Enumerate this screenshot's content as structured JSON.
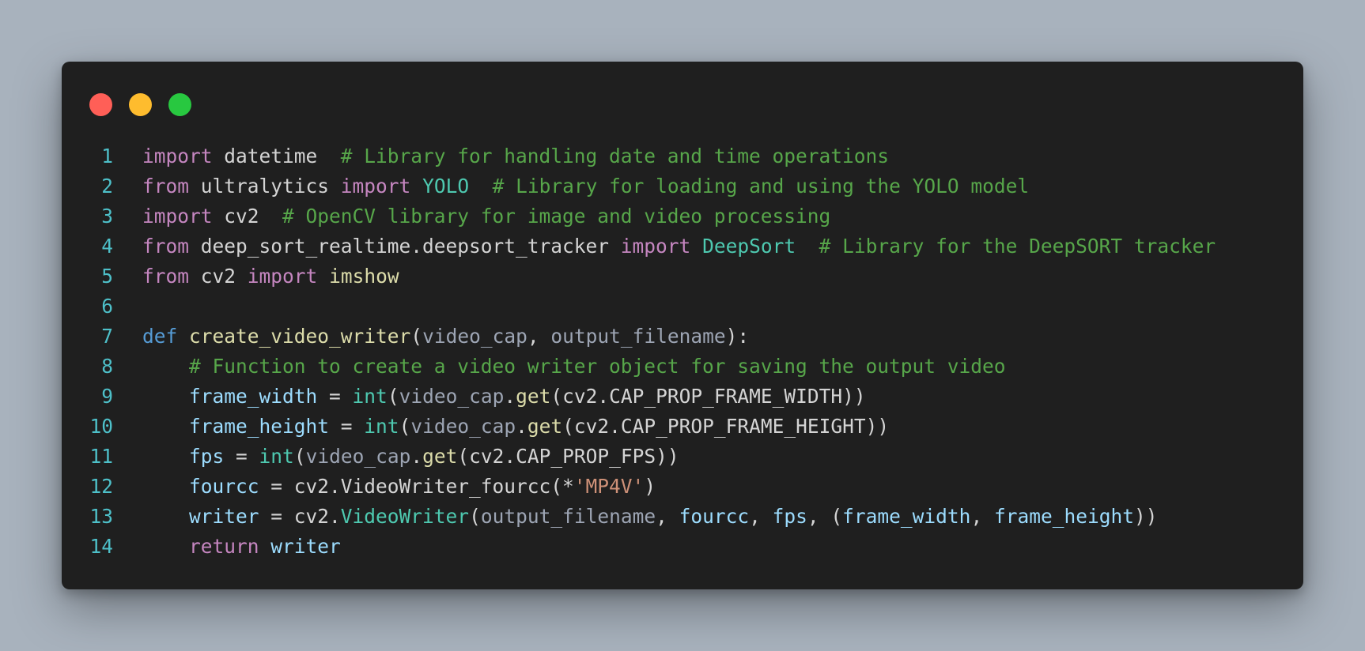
{
  "window": {
    "controls": [
      {
        "name": "close",
        "color": "#ff5f57"
      },
      {
        "name": "minimize",
        "color": "#febc2e"
      },
      {
        "name": "maximize",
        "color": "#28c840"
      }
    ]
  },
  "code": {
    "lines": [
      {
        "num": "1",
        "tokens": [
          {
            "t": "import",
            "c": "keyword"
          },
          {
            "t": " datetime  ",
            "c": "plain"
          },
          {
            "t": "# Library for handling date and time operations",
            "c": "comment"
          }
        ]
      },
      {
        "num": "2",
        "tokens": [
          {
            "t": "from",
            "c": "keyword"
          },
          {
            "t": " ultralytics ",
            "c": "plain"
          },
          {
            "t": "import",
            "c": "keyword"
          },
          {
            "t": " ",
            "c": "plain"
          },
          {
            "t": "YOLO",
            "c": "class"
          },
          {
            "t": "  ",
            "c": "plain"
          },
          {
            "t": "# Library for loading and using the YOLO model",
            "c": "comment"
          }
        ]
      },
      {
        "num": "3",
        "tokens": [
          {
            "t": "import",
            "c": "keyword"
          },
          {
            "t": " cv2  ",
            "c": "plain"
          },
          {
            "t": "# OpenCV library for image and video processing",
            "c": "comment"
          }
        ]
      },
      {
        "num": "4",
        "tokens": [
          {
            "t": "from",
            "c": "keyword"
          },
          {
            "t": " deep_sort_realtime.deepsort_tracker ",
            "c": "plain"
          },
          {
            "t": "import",
            "c": "keyword"
          },
          {
            "t": " ",
            "c": "plain"
          },
          {
            "t": "DeepSort",
            "c": "class"
          },
          {
            "t": "  ",
            "c": "plain"
          },
          {
            "t": "# Library for the DeepSORT tracker",
            "c": "comment"
          }
        ]
      },
      {
        "num": "5",
        "tokens": [
          {
            "t": "from",
            "c": "keyword"
          },
          {
            "t": " cv2 ",
            "c": "plain"
          },
          {
            "t": "import",
            "c": "keyword"
          },
          {
            "t": " ",
            "c": "plain"
          },
          {
            "t": "imshow",
            "c": "func"
          }
        ]
      },
      {
        "num": "6",
        "tokens": []
      },
      {
        "num": "7",
        "tokens": [
          {
            "t": "def",
            "c": "def"
          },
          {
            "t": " ",
            "c": "plain"
          },
          {
            "t": "create_video_writer",
            "c": "func"
          },
          {
            "t": "(",
            "c": "plain"
          },
          {
            "t": "video_cap",
            "c": "param"
          },
          {
            "t": ", ",
            "c": "plain"
          },
          {
            "t": "output_filename",
            "c": "param"
          },
          {
            "t": "):",
            "c": "plain"
          }
        ]
      },
      {
        "num": "8",
        "tokens": [
          {
            "t": "    ",
            "c": "plain"
          },
          {
            "t": "# Function to create a video writer object for saving the output video",
            "c": "comment"
          }
        ]
      },
      {
        "num": "9",
        "tokens": [
          {
            "t": "    ",
            "c": "plain"
          },
          {
            "t": "frame_width",
            "c": "var"
          },
          {
            "t": " = ",
            "c": "plain"
          },
          {
            "t": "int",
            "c": "class"
          },
          {
            "t": "(",
            "c": "plain"
          },
          {
            "t": "video_cap",
            "c": "param"
          },
          {
            "t": ".",
            "c": "plain"
          },
          {
            "t": "get",
            "c": "func"
          },
          {
            "t": "(cv2.CAP_PROP_FRAME_WIDTH))",
            "c": "plain"
          }
        ]
      },
      {
        "num": "10",
        "tokens": [
          {
            "t": "    ",
            "c": "plain"
          },
          {
            "t": "frame_height",
            "c": "var"
          },
          {
            "t": " = ",
            "c": "plain"
          },
          {
            "t": "int",
            "c": "class"
          },
          {
            "t": "(",
            "c": "plain"
          },
          {
            "t": "video_cap",
            "c": "param"
          },
          {
            "t": ".",
            "c": "plain"
          },
          {
            "t": "get",
            "c": "func"
          },
          {
            "t": "(cv2.CAP_PROP_FRAME_HEIGHT))",
            "c": "plain"
          }
        ]
      },
      {
        "num": "11",
        "tokens": [
          {
            "t": "    ",
            "c": "plain"
          },
          {
            "t": "fps",
            "c": "var"
          },
          {
            "t": " = ",
            "c": "plain"
          },
          {
            "t": "int",
            "c": "class"
          },
          {
            "t": "(",
            "c": "plain"
          },
          {
            "t": "video_cap",
            "c": "param"
          },
          {
            "t": ".",
            "c": "plain"
          },
          {
            "t": "get",
            "c": "func"
          },
          {
            "t": "(cv2.CAP_PROP_FPS))",
            "c": "plain"
          }
        ]
      },
      {
        "num": "12",
        "tokens": [
          {
            "t": "    ",
            "c": "plain"
          },
          {
            "t": "fourcc",
            "c": "var"
          },
          {
            "t": " = cv2.VideoWriter_fourcc(*",
            "c": "plain"
          },
          {
            "t": "'MP4V'",
            "c": "string"
          },
          {
            "t": ")",
            "c": "plain"
          }
        ]
      },
      {
        "num": "13",
        "tokens": [
          {
            "t": "    ",
            "c": "plain"
          },
          {
            "t": "writer",
            "c": "var"
          },
          {
            "t": " = cv2.",
            "c": "plain"
          },
          {
            "t": "VideoWriter",
            "c": "class"
          },
          {
            "t": "(",
            "c": "plain"
          },
          {
            "t": "output_filename",
            "c": "param"
          },
          {
            "t": ", ",
            "c": "plain"
          },
          {
            "t": "fourcc",
            "c": "var"
          },
          {
            "t": ", ",
            "c": "plain"
          },
          {
            "t": "fps",
            "c": "var"
          },
          {
            "t": ", (",
            "c": "plain"
          },
          {
            "t": "frame_width",
            "c": "var"
          },
          {
            "t": ", ",
            "c": "plain"
          },
          {
            "t": "frame_height",
            "c": "var"
          },
          {
            "t": "))",
            "c": "plain"
          }
        ]
      },
      {
        "num": "14",
        "tokens": [
          {
            "t": "    ",
            "c": "plain"
          },
          {
            "t": "return",
            "c": "keyword"
          },
          {
            "t": " ",
            "c": "plain"
          },
          {
            "t": "writer",
            "c": "var"
          }
        ]
      }
    ]
  }
}
